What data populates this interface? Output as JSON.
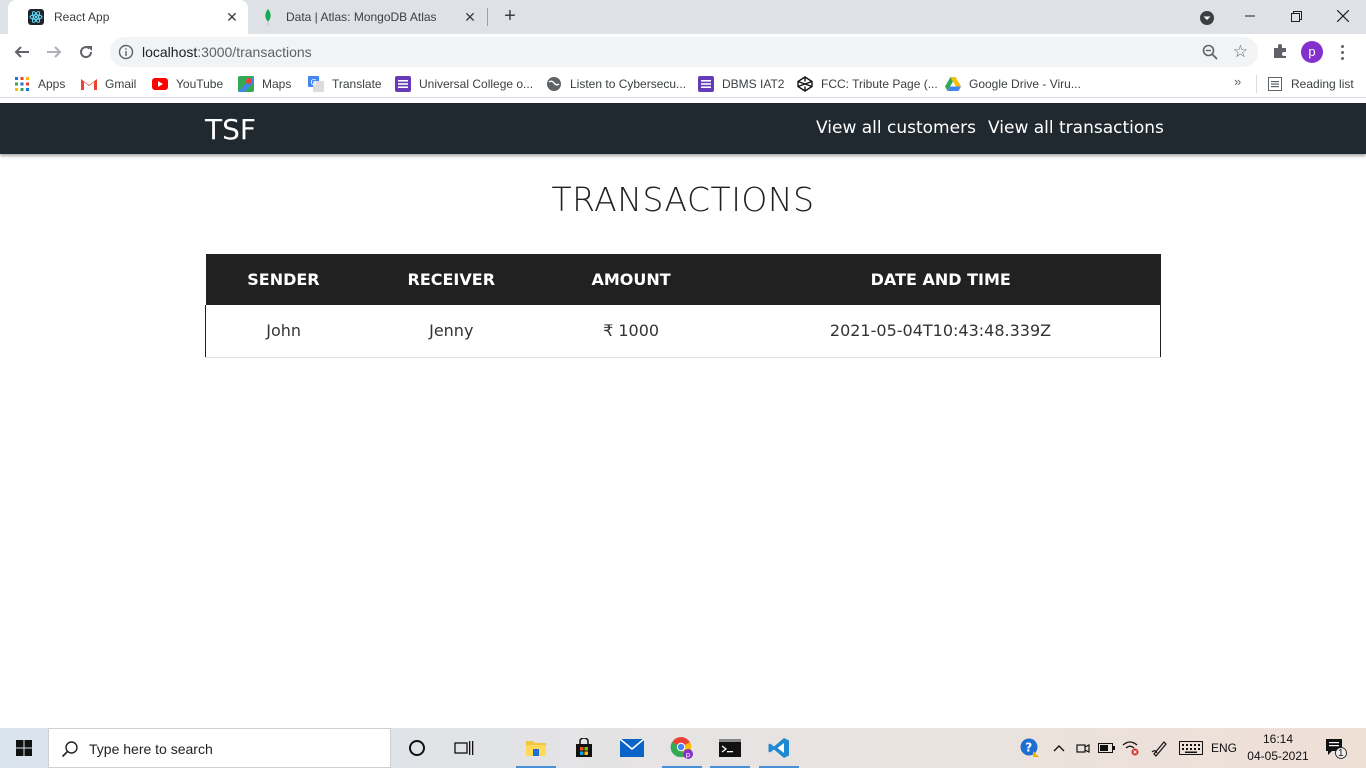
{
  "browser": {
    "tabs": [
      {
        "title": "React App",
        "active": true
      },
      {
        "title": "Data | Atlas: MongoDB Atlas",
        "active": false
      }
    ],
    "url_host": "localhost",
    "url_path": ":3000/transactions",
    "profile_initial": "p",
    "bookmarks": [
      {
        "label": "Apps",
        "icon": "apps-grid-icon"
      },
      {
        "label": "Gmail",
        "icon": "gmail-icon"
      },
      {
        "label": "YouTube",
        "icon": "youtube-icon"
      },
      {
        "label": "Maps",
        "icon": "maps-icon"
      },
      {
        "label": "Translate",
        "icon": "translate-icon"
      },
      {
        "label": "Universal College o...",
        "icon": "classroom-icon"
      },
      {
        "label": "Listen to Cybersecu...",
        "icon": "globe-icon"
      },
      {
        "label": "DBMS IAT2",
        "icon": "classroom-icon"
      },
      {
        "label": "FCC: Tribute Page (...",
        "icon": "codepen-icon"
      },
      {
        "label": "Google Drive - Viru...",
        "icon": "drive-icon"
      }
    ],
    "reading_list": "Reading list",
    "more_bookmarks": "»"
  },
  "app": {
    "brand": "TSF",
    "nav": {
      "customers": "View all customers",
      "transactions": "View all transactions"
    },
    "heading": "TRANSACTIONS",
    "table": {
      "headers": [
        "SENDER",
        "RECEIVER",
        "AMOUNT",
        "DATE AND TIME"
      ],
      "rows": [
        [
          "John",
          "Jenny",
          "₹ 1000",
          "2021-05-04T10:43:48.339Z"
        ]
      ]
    }
  },
  "taskbar": {
    "search_placeholder": "Type here to search",
    "language": "ENG",
    "time": "16:14",
    "date": "04-05-2021",
    "notification_count": "1"
  },
  "colors": {
    "navbar": "#212930",
    "table_header": "#212121",
    "profile": "#8430ce"
  }
}
